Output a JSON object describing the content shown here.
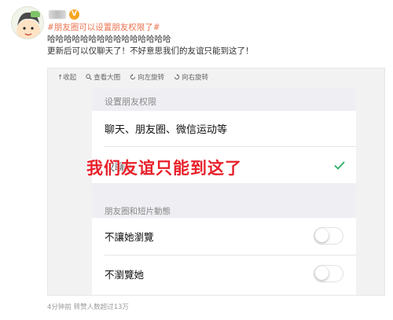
{
  "post": {
    "hashtag": "#朋友圈可以设置朋友权限了#",
    "laugh_line": "哈哈哈哈哈哈哈哈哈哈哈哈哈哈哈",
    "body": "更新后可以仅聊天了！不好意思我们的友谊只能到这了！"
  },
  "badge": {
    "symbol": "V"
  },
  "toolbar": {
    "collapse": "↑收起",
    "view_large": "查看大图",
    "rotate_left": "向左旋转",
    "rotate_right": "向右旋转"
  },
  "screenshot": {
    "section_title": "设置朋友权限",
    "option_all": "聊天、朋友圈、微信运动等",
    "option_chat_only": "仅聊天",
    "check_color": "#2aae67",
    "section2_title": "朋友圈和短片動態",
    "toggle_1_label": "不讓她瀏覽",
    "toggle_2_label": "不瀏覽她",
    "toggle_1_on": false,
    "toggle_2_on": false
  },
  "overlay_caption": "我们友谊只能到这了",
  "footer": "4分钟前 转赞人数超过13万",
  "colors": {
    "hashtag": "#eb7350",
    "overlay_red": "#e8202a"
  }
}
